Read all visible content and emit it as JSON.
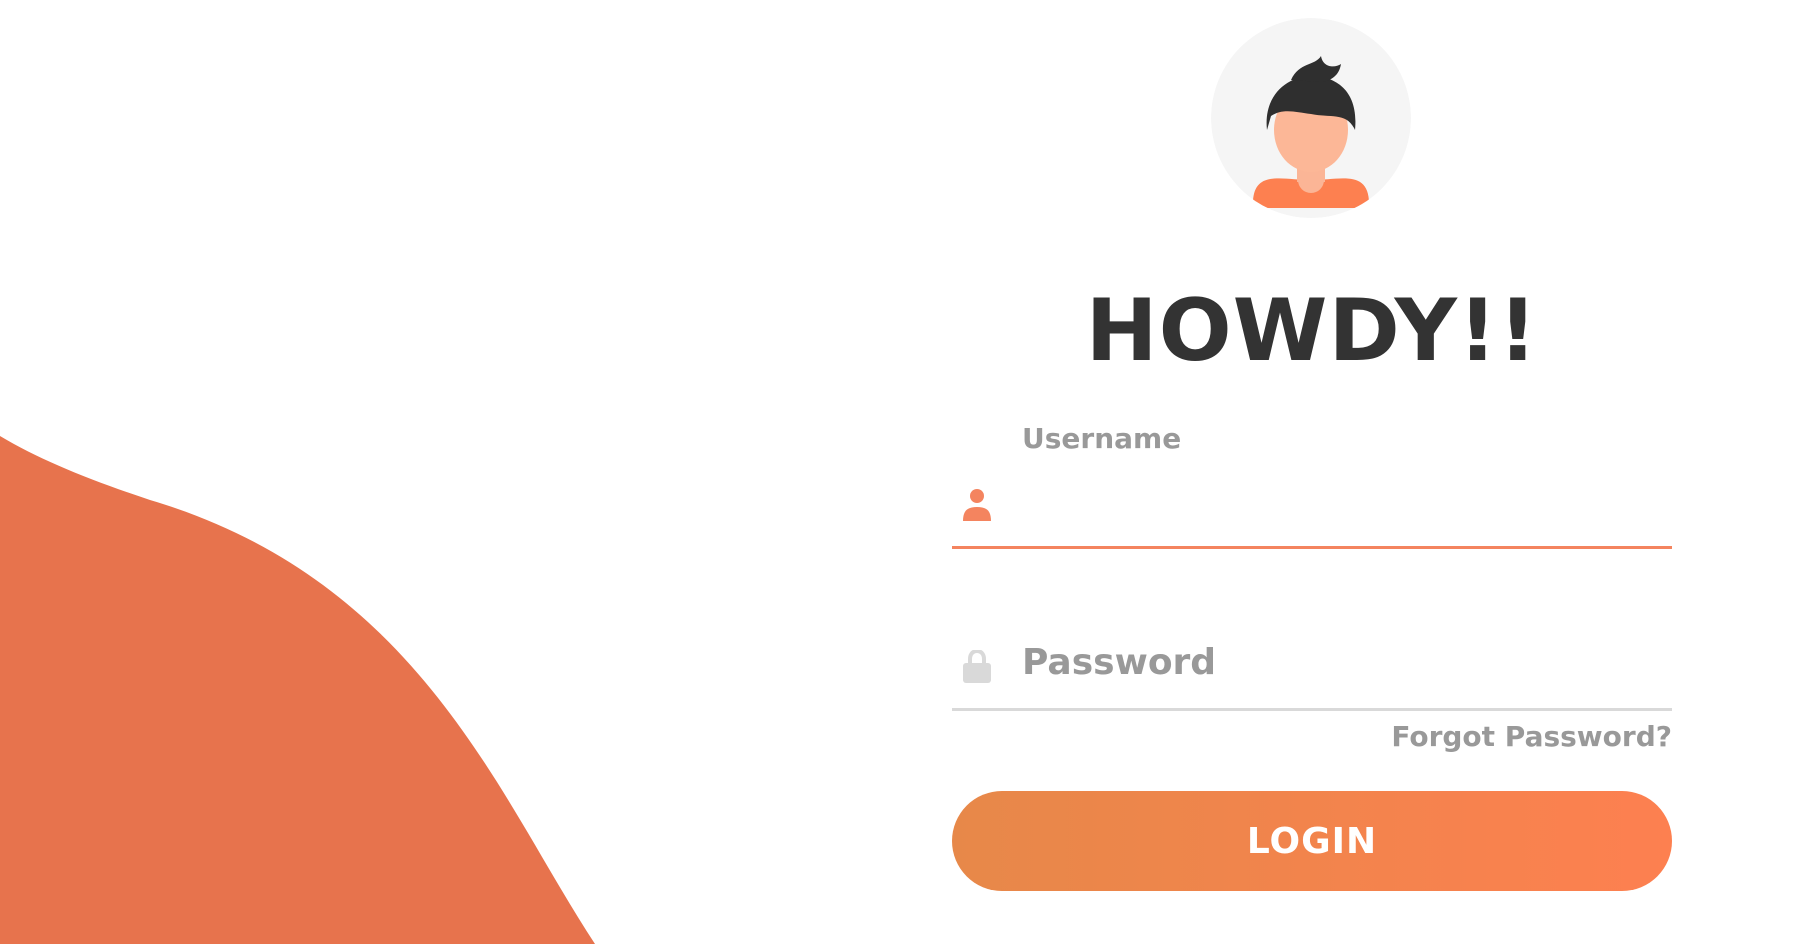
{
  "colors": {
    "accent": "#e7734d",
    "accent_light": "#fd8050",
    "text_dark": "#333333",
    "text_muted": "#999999",
    "underline_inactive": "#d9d9d9"
  },
  "header": {
    "avatar_icon": "user-avatar-illustration",
    "greeting": "HOWDY!!"
  },
  "form": {
    "username": {
      "label": "Username",
      "icon": "user-icon",
      "value": ""
    },
    "password": {
      "label": "Password",
      "icon": "lock-icon",
      "value": ""
    },
    "forgot_password": "Forgot Password?",
    "login_button": "LOGIN"
  }
}
